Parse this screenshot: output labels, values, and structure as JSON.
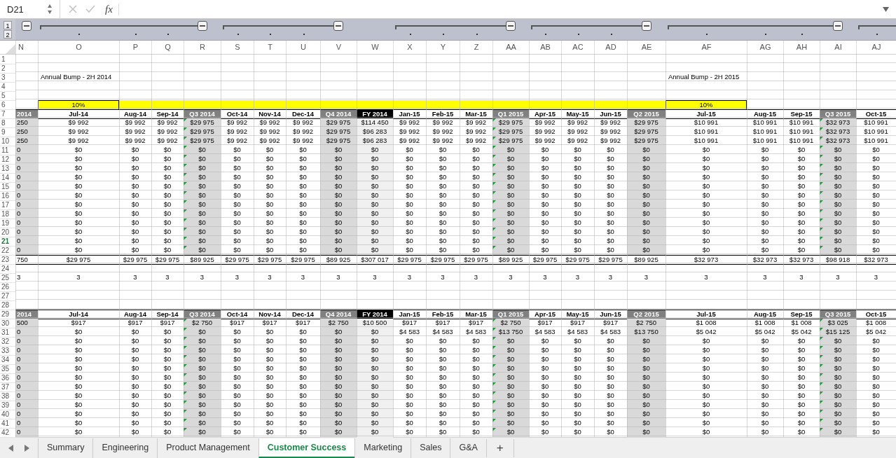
{
  "formula_bar": {
    "name_box": "D21",
    "fx": "fx"
  },
  "outline": {
    "levels": [
      "1",
      "2"
    ]
  },
  "columns": [
    {
      "letter": "N",
      "kind": "quarter",
      "flagged": false
    },
    {
      "letter": "O",
      "kind": "month",
      "flagged": false
    },
    {
      "letter": "P",
      "kind": "month",
      "flagged": false
    },
    {
      "letter": "Q",
      "kind": "month",
      "flagged": false
    },
    {
      "letter": "R",
      "kind": "quarter",
      "flagged": true
    },
    {
      "letter": "S",
      "kind": "month",
      "flagged": false
    },
    {
      "letter": "T",
      "kind": "month",
      "flagged": false
    },
    {
      "letter": "U",
      "kind": "month",
      "flagged": false
    },
    {
      "letter": "V",
      "kind": "quarter",
      "flagged": false
    },
    {
      "letter": "W",
      "kind": "year",
      "flagged": false
    },
    {
      "letter": "X",
      "kind": "month",
      "flagged": false
    },
    {
      "letter": "Y",
      "kind": "month",
      "flagged": false
    },
    {
      "letter": "Z",
      "kind": "month",
      "flagged": false
    },
    {
      "letter": "AA",
      "kind": "quarter",
      "flagged": true
    },
    {
      "letter": "AB",
      "kind": "month",
      "flagged": false
    },
    {
      "letter": "AC",
      "kind": "month",
      "flagged": false
    },
    {
      "letter": "AD",
      "kind": "month",
      "flagged": false
    },
    {
      "letter": "AE",
      "kind": "quarter",
      "flagged": false
    },
    {
      "letter": "AF",
      "kind": "month",
      "flagged": false
    },
    {
      "letter": "AG",
      "kind": "month",
      "flagged": false
    },
    {
      "letter": "AH",
      "kind": "month",
      "flagged": false
    },
    {
      "letter": "AI",
      "kind": "quarter",
      "flagged": true
    },
    {
      "letter": "AJ",
      "kind": "month",
      "flagged": false
    }
  ],
  "rows": [
    {
      "number": "1",
      "kind": "blank",
      "selected": false
    },
    {
      "number": "2",
      "kind": "blank",
      "selected": false
    },
    {
      "number": "3",
      "kind": "label",
      "selected": false,
      "cells": [
        null,
        "Annual Bump - 2H 2014",
        null,
        null,
        null,
        null,
        null,
        null,
        null,
        null,
        null,
        null,
        null,
        null,
        null,
        null,
        null,
        null,
        "Annual Bump - 2H 2015",
        null,
        null,
        null,
        null
      ]
    },
    {
      "number": "4",
      "kind": "blank",
      "selected": false
    },
    {
      "number": "5",
      "kind": "blank",
      "selected": false
    },
    {
      "number": "6",
      "kind": "input",
      "selected": false,
      "cells": [
        null,
        "10%",
        null,
        null,
        null,
        null,
        null,
        null,
        null,
        null,
        null,
        null,
        null,
        null,
        null,
        null,
        null,
        null,
        "10%",
        null,
        null,
        null,
        null
      ]
    },
    {
      "number": "7",
      "kind": "header",
      "selected": false,
      "cells": [
        "2014",
        "Jul-14",
        "Aug-14",
        "Sep-14",
        "Q3 2014",
        "Oct-14",
        "Nov-14",
        "Dec-14",
        "Q4 2014",
        "FY 2014",
        "Jan-15",
        "Feb-15",
        "Mar-15",
        "Q1 2015",
        "Apr-15",
        "May-15",
        "Jun-15",
        "Q2 2015",
        "Jul-15",
        "Aug-15",
        "Sep-15",
        "Q3 2015",
        "Oct-15"
      ]
    },
    {
      "number": "8",
      "kind": "value",
      "selected": false,
      "cells": [
        "250",
        "$9 992",
        "$9 992",
        "$9 992",
        "$29 975",
        "$9 992",
        "$9 992",
        "$9 992",
        "$29 975",
        "$114 450",
        "$9 992",
        "$9 992",
        "$9 992",
        "$29 975",
        "$9 992",
        "$9 992",
        "$9 992",
        "$29 975",
        "$10 991",
        "$10 991",
        "$10 991",
        "$32 973",
        "$10 991"
      ]
    },
    {
      "number": "9",
      "kind": "value",
      "selected": false,
      "cells": [
        "250",
        "$9 992",
        "$9 992",
        "$9 992",
        "$29 975",
        "$9 992",
        "$9 992",
        "$9 992",
        "$29 975",
        "$96 283",
        "$9 992",
        "$9 992",
        "$9 992",
        "$29 975",
        "$9 992",
        "$9 992",
        "$9 992",
        "$29 975",
        "$10 991",
        "$10 991",
        "$10 991",
        "$32 973",
        "$10 991"
      ]
    },
    {
      "number": "10",
      "kind": "value",
      "selected": false,
      "cells": [
        "250",
        "$9 992",
        "$9 992",
        "$9 992",
        "$29 975",
        "$9 992",
        "$9 992",
        "$9 992",
        "$29 975",
        "$96 283",
        "$9 992",
        "$9 992",
        "$9 992",
        "$29 975",
        "$9 992",
        "$9 992",
        "$9 992",
        "$29 975",
        "$10 991",
        "$10 991",
        "$10 991",
        "$32 973",
        "$10 991"
      ]
    },
    {
      "number": "11",
      "kind": "value",
      "selected": false,
      "cells": [
        "0",
        "$0",
        "$0",
        "$0",
        "$0",
        "$0",
        "$0",
        "$0",
        "$0",
        "$0",
        "$0",
        "$0",
        "$0",
        "$0",
        "$0",
        "$0",
        "$0",
        "$0",
        "$0",
        "$0",
        "$0",
        "$0",
        "$0"
      ]
    },
    {
      "number": "12",
      "kind": "value",
      "selected": false,
      "cells": [
        "0",
        "$0",
        "$0",
        "$0",
        "$0",
        "$0",
        "$0",
        "$0",
        "$0",
        "$0",
        "$0",
        "$0",
        "$0",
        "$0",
        "$0",
        "$0",
        "$0",
        "$0",
        "$0",
        "$0",
        "$0",
        "$0",
        "$0"
      ]
    },
    {
      "number": "13",
      "kind": "value",
      "selected": false,
      "cells": [
        "0",
        "$0",
        "$0",
        "$0",
        "$0",
        "$0",
        "$0",
        "$0",
        "$0",
        "$0",
        "$0",
        "$0",
        "$0",
        "$0",
        "$0",
        "$0",
        "$0",
        "$0",
        "$0",
        "$0",
        "$0",
        "$0",
        "$0"
      ]
    },
    {
      "number": "14",
      "kind": "value",
      "selected": false,
      "cells": [
        "0",
        "$0",
        "$0",
        "$0",
        "$0",
        "$0",
        "$0",
        "$0",
        "$0",
        "$0",
        "$0",
        "$0",
        "$0",
        "$0",
        "$0",
        "$0",
        "$0",
        "$0",
        "$0",
        "$0",
        "$0",
        "$0",
        "$0"
      ]
    },
    {
      "number": "15",
      "kind": "value",
      "selected": false,
      "cells": [
        "0",
        "$0",
        "$0",
        "$0",
        "$0",
        "$0",
        "$0",
        "$0",
        "$0",
        "$0",
        "$0",
        "$0",
        "$0",
        "$0",
        "$0",
        "$0",
        "$0",
        "$0",
        "$0",
        "$0",
        "$0",
        "$0",
        "$0"
      ]
    },
    {
      "number": "16",
      "kind": "value",
      "selected": false,
      "cells": [
        "0",
        "$0",
        "$0",
        "$0",
        "$0",
        "$0",
        "$0",
        "$0",
        "$0",
        "$0",
        "$0",
        "$0",
        "$0",
        "$0",
        "$0",
        "$0",
        "$0",
        "$0",
        "$0",
        "$0",
        "$0",
        "$0",
        "$0"
      ]
    },
    {
      "number": "17",
      "kind": "value",
      "selected": false,
      "cells": [
        "0",
        "$0",
        "$0",
        "$0",
        "$0",
        "$0",
        "$0",
        "$0",
        "$0",
        "$0",
        "$0",
        "$0",
        "$0",
        "$0",
        "$0",
        "$0",
        "$0",
        "$0",
        "$0",
        "$0",
        "$0",
        "$0",
        "$0"
      ]
    },
    {
      "number": "18",
      "kind": "value",
      "selected": false,
      "cells": [
        "0",
        "$0",
        "$0",
        "$0",
        "$0",
        "$0",
        "$0",
        "$0",
        "$0",
        "$0",
        "$0",
        "$0",
        "$0",
        "$0",
        "$0",
        "$0",
        "$0",
        "$0",
        "$0",
        "$0",
        "$0",
        "$0",
        "$0"
      ]
    },
    {
      "number": "19",
      "kind": "value",
      "selected": false,
      "cells": [
        "0",
        "$0",
        "$0",
        "$0",
        "$0",
        "$0",
        "$0",
        "$0",
        "$0",
        "$0",
        "$0",
        "$0",
        "$0",
        "$0",
        "$0",
        "$0",
        "$0",
        "$0",
        "$0",
        "$0",
        "$0",
        "$0",
        "$0"
      ]
    },
    {
      "number": "20",
      "kind": "value",
      "selected": false,
      "cells": [
        "0",
        "$0",
        "$0",
        "$0",
        "$0",
        "$0",
        "$0",
        "$0",
        "$0",
        "$0",
        "$0",
        "$0",
        "$0",
        "$0",
        "$0",
        "$0",
        "$0",
        "$0",
        "$0",
        "$0",
        "$0",
        "$0",
        "$0"
      ]
    },
    {
      "number": "21",
      "kind": "value",
      "selected": true,
      "cells": [
        "0",
        "$0",
        "$0",
        "$0",
        "$0",
        "$0",
        "$0",
        "$0",
        "$0",
        "$0",
        "$0",
        "$0",
        "$0",
        "$0",
        "$0",
        "$0",
        "$0",
        "$0",
        "$0",
        "$0",
        "$0",
        "$0",
        "$0"
      ]
    },
    {
      "number": "22",
      "kind": "value",
      "selected": false,
      "cells": [
        "0",
        "$0",
        "$0",
        "$0",
        "$0",
        "$0",
        "$0",
        "$0",
        "$0",
        "$0",
        "$0",
        "$0",
        "$0",
        "$0",
        "$0",
        "$0",
        "$0",
        "$0",
        "$0",
        "$0",
        "$0",
        "$0",
        "$0"
      ]
    },
    {
      "number": "23",
      "kind": "total",
      "selected": false,
      "cells": [
        "750",
        "$29 975",
        "$29 975",
        "$29 975",
        "$89 925",
        "$29 975",
        "$29 975",
        "$29 975",
        "$89 925",
        "$307 017",
        "$29 975",
        "$29 975",
        "$29 975",
        "$89 925",
        "$29 975",
        "$29 975",
        "$29 975",
        "$89 925",
        "$32 973",
        "$32 973",
        "$32 973",
        "$98 918",
        "$32 973"
      ]
    },
    {
      "number": "24",
      "kind": "blank",
      "selected": false
    },
    {
      "number": "25",
      "kind": "count",
      "selected": false,
      "cells": [
        "3",
        "3",
        "3",
        "3",
        "3",
        "3",
        "3",
        "3",
        "3",
        "3",
        "3",
        "3",
        "3",
        "3",
        "3",
        "3",
        "3",
        "3",
        "3",
        "3",
        "3",
        "3",
        "3"
      ]
    },
    {
      "number": "26",
      "kind": "blank",
      "selected": false
    },
    {
      "number": "27",
      "kind": "blank",
      "selected": false
    },
    {
      "number": "28",
      "kind": "blank",
      "selected": false
    },
    {
      "number": "29",
      "kind": "header",
      "selected": false,
      "cells": [
        "2014",
        "Jul-14",
        "Aug-14",
        "Sep-14",
        "Q3 2014",
        "Oct-14",
        "Nov-14",
        "Dec-14",
        "Q4 2014",
        "FY 2014",
        "Jan-15",
        "Feb-15",
        "Mar-15",
        "Q1 2015",
        "Apr-15",
        "May-15",
        "Jun-15",
        "Q2 2015",
        "Jul-15",
        "Aug-15",
        "Sep-15",
        "Q3 2015",
        "Oct-15"
      ]
    },
    {
      "number": "30",
      "kind": "value",
      "selected": false,
      "cells": [
        "500",
        "$917",
        "$917",
        "$917",
        "$2 750",
        "$917",
        "$917",
        "$917",
        "$2 750",
        "$10 500",
        "$917",
        "$917",
        "$917",
        "$2 750",
        "$917",
        "$917",
        "$917",
        "$2 750",
        "$1 008",
        "$1 008",
        "$1 008",
        "$3 025",
        "$1 008"
      ]
    },
    {
      "number": "31",
      "kind": "value",
      "selected": false,
      "cells": [
        "0",
        "$0",
        "$0",
        "$0",
        "$0",
        "$0",
        "$0",
        "$0",
        "$0",
        "$0",
        "$4 583",
        "$4 583",
        "$4 583",
        "$13 750",
        "$4 583",
        "$4 583",
        "$4 583",
        "$13 750",
        "$5 042",
        "$5 042",
        "$5 042",
        "$15 125",
        "$5 042"
      ]
    },
    {
      "number": "32",
      "kind": "value",
      "selected": false,
      "cells": [
        "0",
        "$0",
        "$0",
        "$0",
        "$0",
        "$0",
        "$0",
        "$0",
        "$0",
        "$0",
        "$0",
        "$0",
        "$0",
        "$0",
        "$0",
        "$0",
        "$0",
        "$0",
        "$0",
        "$0",
        "$0",
        "$0",
        "$0"
      ]
    },
    {
      "number": "33",
      "kind": "value",
      "selected": false,
      "cells": [
        "0",
        "$0",
        "$0",
        "$0",
        "$0",
        "$0",
        "$0",
        "$0",
        "$0",
        "$0",
        "$0",
        "$0",
        "$0",
        "$0",
        "$0",
        "$0",
        "$0",
        "$0",
        "$0",
        "$0",
        "$0",
        "$0",
        "$0"
      ]
    },
    {
      "number": "34",
      "kind": "value",
      "selected": false,
      "cells": [
        "0",
        "$0",
        "$0",
        "$0",
        "$0",
        "$0",
        "$0",
        "$0",
        "$0",
        "$0",
        "$0",
        "$0",
        "$0",
        "$0",
        "$0",
        "$0",
        "$0",
        "$0",
        "$0",
        "$0",
        "$0",
        "$0",
        "$0"
      ]
    },
    {
      "number": "35",
      "kind": "value",
      "selected": false,
      "cells": [
        "0",
        "$0",
        "$0",
        "$0",
        "$0",
        "$0",
        "$0",
        "$0",
        "$0",
        "$0",
        "$0",
        "$0",
        "$0",
        "$0",
        "$0",
        "$0",
        "$0",
        "$0",
        "$0",
        "$0",
        "$0",
        "$0",
        "$0"
      ]
    },
    {
      "number": "36",
      "kind": "value",
      "selected": false,
      "cells": [
        "0",
        "$0",
        "$0",
        "$0",
        "$0",
        "$0",
        "$0",
        "$0",
        "$0",
        "$0",
        "$0",
        "$0",
        "$0",
        "$0",
        "$0",
        "$0",
        "$0",
        "$0",
        "$0",
        "$0",
        "$0",
        "$0",
        "$0"
      ]
    },
    {
      "number": "37",
      "kind": "value",
      "selected": false,
      "cells": [
        "0",
        "$0",
        "$0",
        "$0",
        "$0",
        "$0",
        "$0",
        "$0",
        "$0",
        "$0",
        "$0",
        "$0",
        "$0",
        "$0",
        "$0",
        "$0",
        "$0",
        "$0",
        "$0",
        "$0",
        "$0",
        "$0",
        "$0"
      ]
    },
    {
      "number": "38",
      "kind": "value",
      "selected": false,
      "cells": [
        "0",
        "$0",
        "$0",
        "$0",
        "$0",
        "$0",
        "$0",
        "$0",
        "$0",
        "$0",
        "$0",
        "$0",
        "$0",
        "$0",
        "$0",
        "$0",
        "$0",
        "$0",
        "$0",
        "$0",
        "$0",
        "$0",
        "$0"
      ]
    },
    {
      "number": "39",
      "kind": "value",
      "selected": false,
      "cells": [
        "0",
        "$0",
        "$0",
        "$0",
        "$0",
        "$0",
        "$0",
        "$0",
        "$0",
        "$0",
        "$0",
        "$0",
        "$0",
        "$0",
        "$0",
        "$0",
        "$0",
        "$0",
        "$0",
        "$0",
        "$0",
        "$0",
        "$0"
      ]
    },
    {
      "number": "40",
      "kind": "value",
      "selected": false,
      "cells": [
        "0",
        "$0",
        "$0",
        "$0",
        "$0",
        "$0",
        "$0",
        "$0",
        "$0",
        "$0",
        "$0",
        "$0",
        "$0",
        "$0",
        "$0",
        "$0",
        "$0",
        "$0",
        "$0",
        "$0",
        "$0",
        "$0",
        "$0"
      ]
    },
    {
      "number": "41",
      "kind": "value",
      "selected": false,
      "cells": [
        "0",
        "$0",
        "$0",
        "$0",
        "$0",
        "$0",
        "$0",
        "$0",
        "$0",
        "$0",
        "$0",
        "$0",
        "$0",
        "$0",
        "$0",
        "$0",
        "$0",
        "$0",
        "$0",
        "$0",
        "$0",
        "$0",
        "$0"
      ]
    },
    {
      "number": "42",
      "kind": "value",
      "selected": false,
      "cells": [
        "0",
        "$0",
        "$0",
        "$0",
        "$0",
        "$0",
        "$0",
        "$0",
        "$0",
        "$0",
        "$0",
        "$0",
        "$0",
        "$0",
        "$0",
        "$0",
        "$0",
        "$0",
        "$0",
        "$0",
        "$0",
        "$0",
        "$0"
      ]
    }
  ],
  "sheet_tabs": [
    {
      "label": "Summary",
      "selected": false
    },
    {
      "label": "Engineering",
      "selected": false
    },
    {
      "label": "Product Management",
      "selected": false
    },
    {
      "label": "Customer Success",
      "selected": true
    },
    {
      "label": "Marketing",
      "selected": false
    },
    {
      "label": "Sales",
      "selected": false
    },
    {
      "label": "G&A",
      "selected": false
    }
  ],
  "add_sheet": "+"
}
